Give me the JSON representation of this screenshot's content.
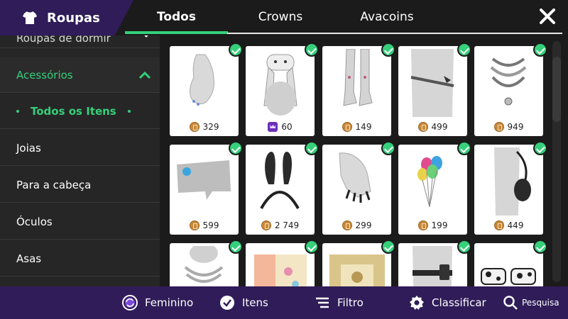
{
  "header": {
    "brand_title": "Roupas",
    "tabs": [
      {
        "label": "Todos",
        "active": true
      },
      {
        "label": "Crowns",
        "active": false
      },
      {
        "label": "Avacoins",
        "active": false
      }
    ],
    "close_icon": "close-icon"
  },
  "sidebar": {
    "partial_label": "Roupas de dormir",
    "active_category": "Acessórios",
    "sub_item": "Todos os Itens",
    "items": [
      "Joias",
      "Para a cabeça",
      "Óculos",
      "Asas"
    ]
  },
  "grid": {
    "items": [
      {
        "name": "gloves",
        "currency": "avacoin",
        "price": "329"
      },
      {
        "name": "bunny-hat",
        "currency": "crown",
        "price": "60"
      },
      {
        "name": "leg-warmers",
        "currency": "avacoin",
        "price": "149"
      },
      {
        "name": "spike-belt",
        "currency": "avacoin",
        "price": "499"
      },
      {
        "name": "necklace",
        "currency": "avacoin",
        "price": "949"
      },
      {
        "name": "bytes-sign",
        "currency": "avacoin",
        "price": "599"
      },
      {
        "name": "bunny-ears",
        "currency": "avacoin",
        "price": "2 749"
      },
      {
        "name": "claw-nails",
        "currency": "avacoin",
        "price": "299"
      },
      {
        "name": "balloons",
        "currency": "avacoin",
        "price": "199"
      },
      {
        "name": "shoulder-bag",
        "currency": "avacoin",
        "price": "449"
      },
      {
        "name": "pearl-necklace",
        "currency": "avacoin",
        "price": ""
      },
      {
        "name": "floral-book",
        "currency": "avacoin",
        "price": ""
      },
      {
        "name": "gold-frame",
        "currency": "avacoin",
        "price": ""
      },
      {
        "name": "phone-belt",
        "currency": "avacoin",
        "price": ""
      },
      {
        "name": "cow-sunglasses",
        "currency": "avacoin",
        "price": ""
      }
    ]
  },
  "bottom_bar": {
    "gender_label": "Feminino",
    "items_label": "Itens",
    "filter_label": "Filtro",
    "sort_label": "Classificar",
    "search_label": "Pesquisa"
  },
  "colors": {
    "accent_green": "#35d07a",
    "brand_purple": "#2f1c58",
    "avacoin": "#c8893b",
    "crown": "#6a2fb8"
  }
}
